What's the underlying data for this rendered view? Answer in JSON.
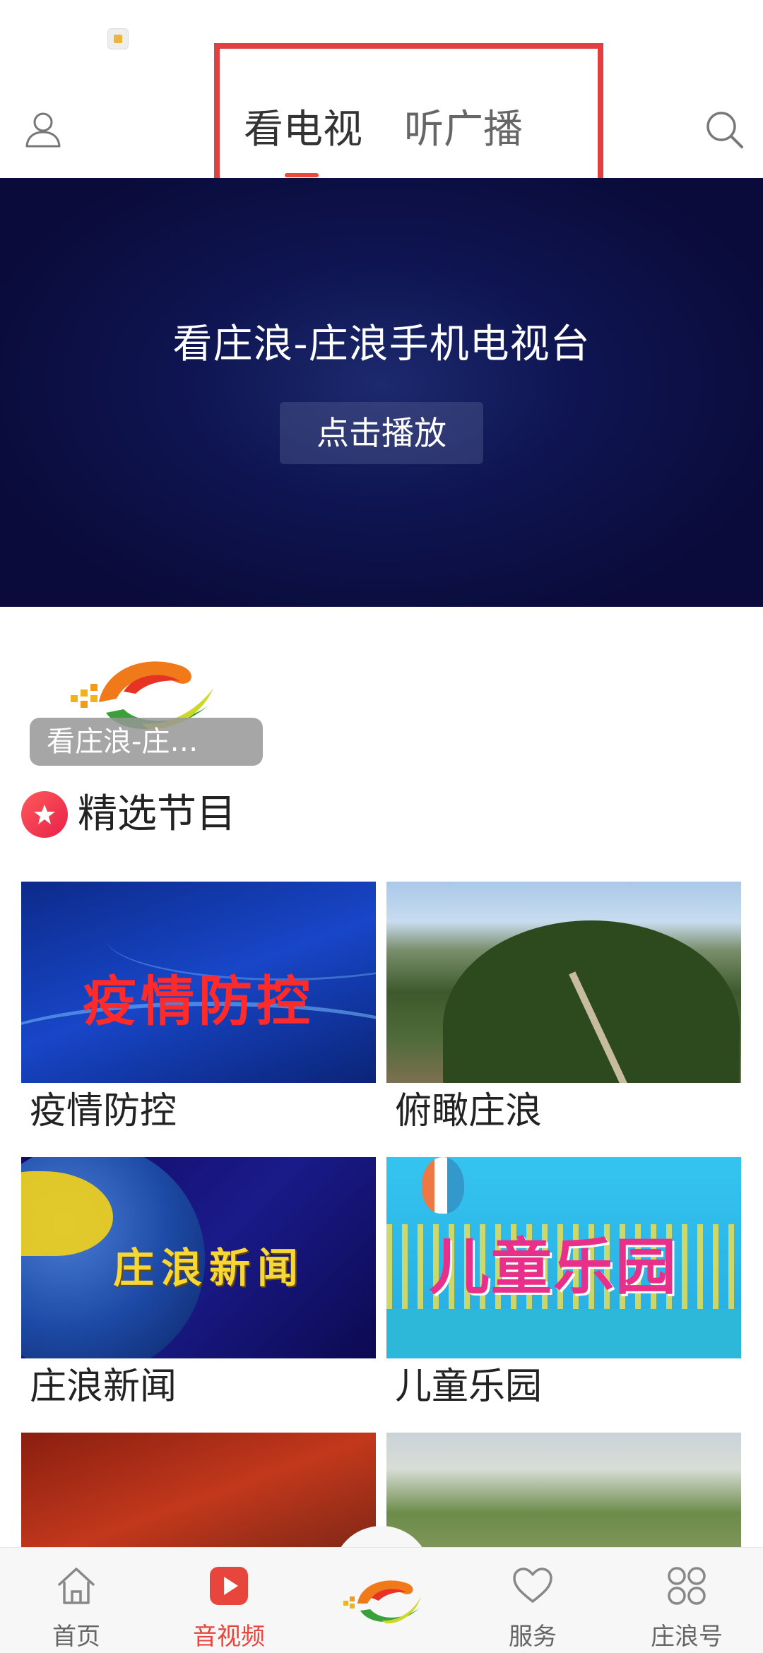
{
  "top_bar": {
    "tabs": [
      {
        "label": "看电视",
        "active": true
      },
      {
        "label": "听广播",
        "active": false
      }
    ],
    "profile_icon": "user-icon",
    "search_icon": "search-icon",
    "accent_color": "#e84b3c"
  },
  "hero": {
    "title": "看庄浪-庄浪手机电视台",
    "play_button": "点击播放"
  },
  "channel_card": {
    "label": "看庄浪-庄…"
  },
  "featured": {
    "title": "精选节目",
    "items": [
      {
        "title": "疫情防控",
        "thumb_text": "疫情防控"
      },
      {
        "title": "俯瞰庄浪",
        "thumb_text": ""
      },
      {
        "title": "庄浪新闻",
        "thumb_text": "庄浪新闻"
      },
      {
        "title": "儿童乐园",
        "thumb_text": "儿童乐园"
      }
    ]
  },
  "bottom_nav": {
    "items": [
      {
        "label": "首页",
        "icon": "home-icon"
      },
      {
        "label": "音视频",
        "icon": "play-icon",
        "active": true
      },
      {
        "label": "服务",
        "icon": "heart-icon"
      },
      {
        "label": "庄浪号",
        "icon": "grid-icon"
      }
    ],
    "center_icon": "zhuanglang-logo"
  }
}
